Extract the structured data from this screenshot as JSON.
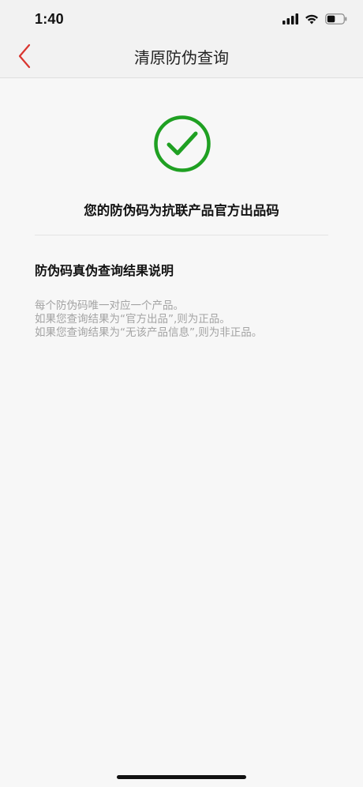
{
  "status_bar": {
    "time": "1:40",
    "icons": [
      "signal-icon",
      "wifi-icon",
      "battery-icon"
    ]
  },
  "nav": {
    "back_icon": "chevron-left-icon",
    "title": "清原防伪查询"
  },
  "result": {
    "icon": "check-circle-icon",
    "text": "您的防伪码为抗联产品官方出品码"
  },
  "explanation": {
    "heading": "防伪码真伪查询结果说明",
    "lines": [
      "每个防伪码唯一对应一个产品。",
      "如果您查询结果为“官方出品”,则为正品。",
      "如果您查询结果为“无该产品信息”,则为非正品。"
    ]
  },
  "colors": {
    "accent_back": "#d9352f",
    "success_green": "#1fa022",
    "muted_text": "#a3a3a3"
  }
}
